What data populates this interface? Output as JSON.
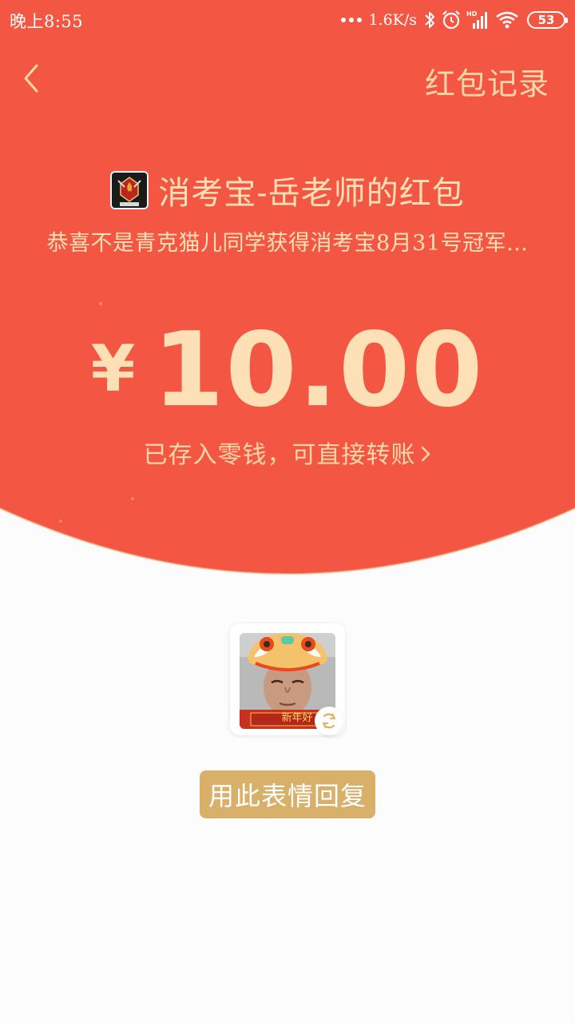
{
  "status_bar": {
    "time": "晚上8:55",
    "net_speed": "1.6K/s",
    "battery": "53",
    "icons": [
      "more-dots-icon",
      "bluetooth-icon",
      "alarm-icon",
      "hd-signal-icon",
      "wifi-icon",
      "battery-icon"
    ]
  },
  "nav": {
    "back_icon": "chevron-left-icon",
    "record_label": "红包记录"
  },
  "sender": {
    "logo_icon": "fire-badge-logo-icon",
    "title": "消考宝-岳老师的红包",
    "wish": "恭喜不是青克猫儿同学获得消考宝8月31号冠军…"
  },
  "amount": {
    "currency": "¥",
    "value": "10.00",
    "note": "已存入零钱，可直接转账"
  },
  "sticker": {
    "banner_text": "新年好",
    "refresh_icon": "refresh-icon"
  },
  "reply_button": "用此表情回复",
  "colors": {
    "header_red": "#f35744",
    "gold_text": "#fde0b5",
    "reply_gold": "#d8b06a",
    "page_bg": "#fcfcfc"
  }
}
